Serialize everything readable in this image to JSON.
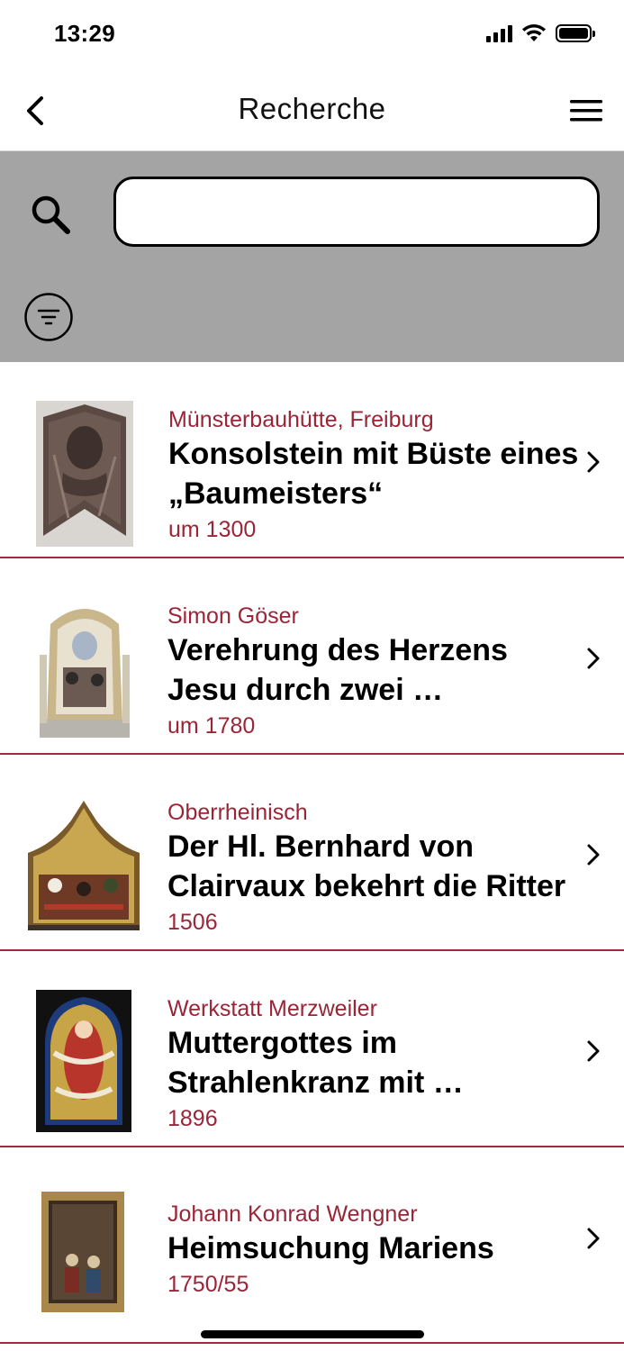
{
  "status_bar": {
    "time": "13:29"
  },
  "nav": {
    "title": "Recherche"
  },
  "search": {
    "value": "",
    "placeholder": ""
  },
  "results": [
    {
      "artist": "Münsterbauhütte, Freiburg",
      "title": "Konsolstein mit Büste eines „Baumeisters“",
      "date": "um 1300",
      "thumbnail": "stone-bust-artwork"
    },
    {
      "artist": "Simon Göser",
      "title": "Verehrung des Herzens Jesu durch zwei …",
      "date": "um 1780",
      "thumbnail": "altar-painting-artwork"
    },
    {
      "artist": "Oberrheinisch",
      "title": "Der Hl. Bernhard von Clairvaux bekehrt die Ritter",
      "date": "1506",
      "thumbnail": "gothic-panel-artwork"
    },
    {
      "artist": "Werkstatt Merzweiler",
      "title": "Muttergottes im Strahlenkranz mit …",
      "date": "1896",
      "thumbnail": "stained-glass-artwork"
    },
    {
      "artist": "Johann Konrad Wengner",
      "title": "Heimsuchung Mariens",
      "date": "1750/55",
      "thumbnail": "framed-painting-artwork"
    }
  ],
  "colors": {
    "accent": "#9b2437",
    "search_panel_bg": "#a4a4a4",
    "divider": "#a02b3e"
  }
}
